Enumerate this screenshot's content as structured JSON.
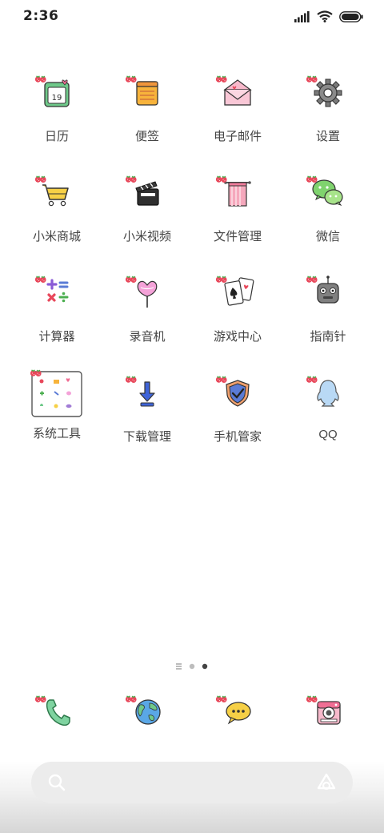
{
  "status_bar": {
    "time": "2:36"
  },
  "apps": [
    {
      "label": "日历",
      "icon": "calendar-icon",
      "day": "19"
    },
    {
      "label": "便签",
      "icon": "notes-icon"
    },
    {
      "label": "电子邮件",
      "icon": "mail-icon"
    },
    {
      "label": "设置",
      "icon": "gear-icon"
    },
    {
      "label": "小米商城",
      "icon": "cart-icon"
    },
    {
      "label": "小米视频",
      "icon": "clapper-icon"
    },
    {
      "label": "文件管理",
      "icon": "towel-icon"
    },
    {
      "label": "微信",
      "icon": "wechat-icon"
    },
    {
      "label": "计算器",
      "icon": "calculator-icon"
    },
    {
      "label": "录音机",
      "icon": "recorder-icon"
    },
    {
      "label": "游戏中心",
      "icon": "playing-cards-icon"
    },
    {
      "label": "指南针",
      "icon": "compass-robot-icon"
    },
    {
      "label": "系统工具",
      "icon": "folder-icon"
    },
    {
      "label": "下载管理",
      "icon": "download-icon"
    },
    {
      "label": "手机管家",
      "icon": "shield-icon"
    },
    {
      "label": "QQ",
      "icon": "qq-icon"
    }
  ],
  "dock": [
    {
      "icon": "phone-icon"
    },
    {
      "icon": "globe-icon"
    },
    {
      "icon": "message-icon"
    },
    {
      "icon": "camera-icon"
    }
  ],
  "page_indicator": {
    "pages": 3,
    "active": 2
  },
  "colors": {
    "accent_pink": "#f39ab4",
    "strawberry": "#e8485b",
    "leaf": "#4caf50",
    "label": "#444444"
  }
}
